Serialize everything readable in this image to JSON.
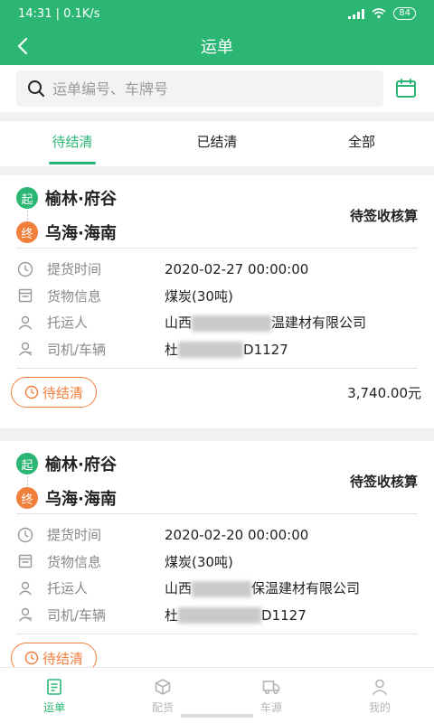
{
  "status_bar": {
    "time": "14:31 | 0.1K/s",
    "battery": "84"
  },
  "nav": {
    "title": "运单"
  },
  "search": {
    "placeholder": "运单编号、车牌号"
  },
  "tabs": [
    {
      "label": "待结清"
    },
    {
      "label": "已结清"
    },
    {
      "label": "全部"
    }
  ],
  "orders": [
    {
      "start_badge": "起",
      "end_badge": "终",
      "origin": "榆林·府谷",
      "destination": "乌海·海南",
      "status": "待签收核算",
      "rows": [
        {
          "label": "提货时间",
          "value": "2020-02-27 00:00:00"
        },
        {
          "label": "货物信息",
          "value": "煤炭(30吨)"
        },
        {
          "label": "托运人",
          "value_pre": "山西",
          "value_post": "温建材有限公司"
        },
        {
          "label": "司机/车辆",
          "value_pre": "杜",
          "value_post": "D1127"
        }
      ],
      "pill": "待结清",
      "amount": "3,740.00元"
    },
    {
      "start_badge": "起",
      "end_badge": "终",
      "origin": "榆林·府谷",
      "destination": "乌海·海南",
      "status": "待签收核算",
      "rows": [
        {
          "label": "提货时间",
          "value": "2020-02-20 00:00:00"
        },
        {
          "label": "货物信息",
          "value": "煤炭(30吨)"
        },
        {
          "label": "托运人",
          "value_pre": "山西",
          "value_post": "保温建材有限公司"
        },
        {
          "label": "司机/车辆",
          "value_pre": "杜",
          "value_post": "D1127"
        }
      ],
      "pill": "待结清"
    }
  ],
  "bottom_nav": [
    {
      "label": "运单"
    },
    {
      "label": "配货"
    },
    {
      "label": "车源"
    },
    {
      "label": "我的"
    }
  ],
  "colors": {
    "brand": "#2bb673",
    "accent": "#f07f3c"
  }
}
